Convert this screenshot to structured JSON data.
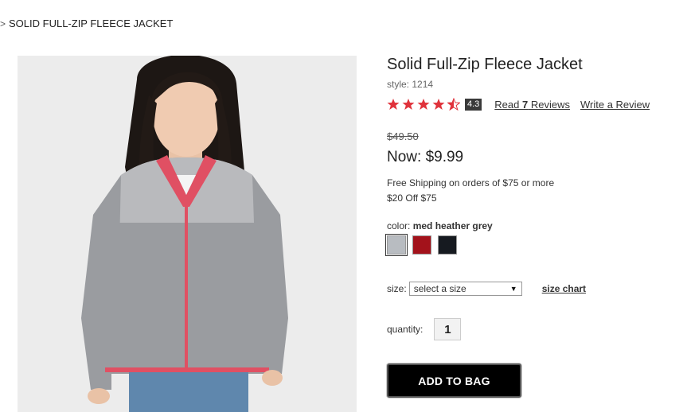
{
  "breadcrumb": {
    "separator": ">",
    "current": "SOLID FULL-ZIP FLEECE JACKET"
  },
  "product": {
    "title": "Solid Full-Zip Fleece Jacket",
    "style_label": "style: 1214",
    "rating_value": "4.3",
    "rating_stars": 4.3,
    "star_color": "#e0323b",
    "reviews_prefix": "Read ",
    "reviews_count": "7",
    "reviews_suffix": " Reviews",
    "write_review": "Write a Review",
    "was_price": "$49.50",
    "now_price": "Now: $9.99",
    "promo_shipping": "Free Shipping on orders of $75 or more",
    "promo_discount": "$20 Off $75"
  },
  "color": {
    "label": "color: ",
    "value": "med heather grey",
    "swatches": [
      {
        "name": "med heather grey",
        "hex": "#b8bcc1",
        "selected": true
      },
      {
        "name": "red",
        "hex": "#a3121b",
        "selected": false
      },
      {
        "name": "black",
        "hex": "#161a20",
        "selected": false
      }
    ]
  },
  "size": {
    "label": "size:",
    "placeholder": "select a size",
    "chart_link": "size chart"
  },
  "quantity": {
    "label": "quantity:",
    "value": "1"
  },
  "cta": {
    "add_to_bag": "ADD TO BAG"
  }
}
